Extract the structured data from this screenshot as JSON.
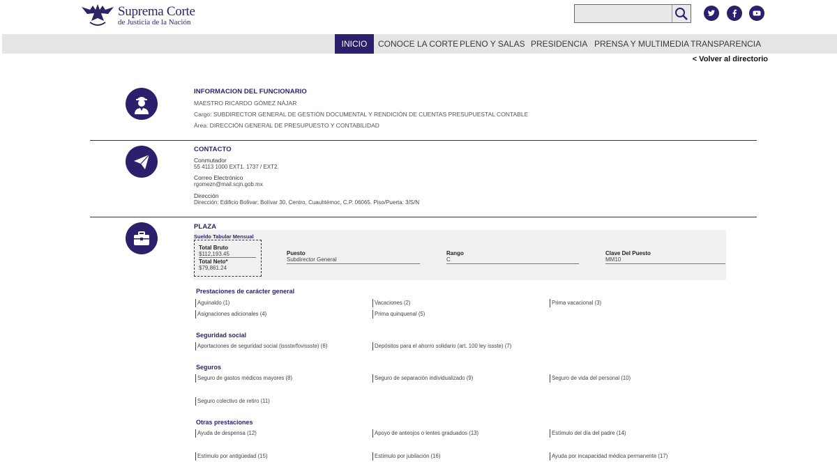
{
  "header": {
    "logo_title": "Suprema Corte",
    "logo_subtitle": "de Justicia de la Nación",
    "search": {
      "value": "",
      "placeholder": ""
    }
  },
  "nav": {
    "items": [
      {
        "label": "INICIO",
        "active": true
      },
      {
        "label": "CONOCE LA CORTE",
        "active": false
      },
      {
        "label": "PLENO Y SALAS",
        "active": false
      },
      {
        "label": "PRESIDENCIA",
        "active": false
      },
      {
        "label": "PRENSA Y MULTIMEDIA",
        "active": false
      },
      {
        "label": "TRANSPARENCIA",
        "active": false
      }
    ],
    "back_link": "< Volver al directorio"
  },
  "colors": {
    "brand": "#2c1f6b",
    "nav_bg": "#e5e5e5",
    "box_bg": "#f1f1f1"
  },
  "official": {
    "heading": "INFORMACION DEL FUNCIONARIO",
    "name": "MAESTRO RICARDO GÓMEZ NÁJAR",
    "cargo": "Cargo: SUBDIRECTOR GENERAL DE GESTIÓN DOCUMENTAL Y RENDICIÓN DE CUENTAS PRESUPUESTAL CONTABLE",
    "area": "Área: DIRECCIÓN GENERAL DE PRESUPUESTO Y CONTABILIDAD",
    "icon": "person-icon"
  },
  "contact": {
    "heading": "CONTACTO",
    "icon": "paper-plane-icon",
    "conmutador_label": "Conmutador",
    "conmutador_value": "55 4113 1000 EXT1. 1737 / EXT2.",
    "email_label": "Correo Electrónico",
    "email_value": "rgomezn@mail.scjn.gob.mx",
    "address_label": "Dirección",
    "address_value": "Dirección: Edificio Bolívar; Bolívar 30, Centro, Cuauhtémoc, C.P. 06065. Piso/Puerta: 3/S/N"
  },
  "plaza": {
    "heading": "PLAZA",
    "icon": "briefcase-icon",
    "sueldo_label": "Sueldo Tabular Mensual",
    "bruto_label": "Total Bruto",
    "bruto_value": "$112,193.45",
    "neto_label": "Total Neto*",
    "neto_value": "$79,861.24",
    "puesto_label": "Puesto",
    "puesto_value": "Subdirector General",
    "rango_label": "Rango",
    "rango_value": "C",
    "clave_label": "Clave Del Puesto",
    "clave_value": "MM10"
  },
  "benefits": [
    {
      "title": "Prestaciones de carácter general",
      "items": [
        "Aguinaldo (1)",
        "Vacaciones (2)",
        "Prima vacacional (3)",
        "Asignaciones adicionales (4)",
        "Prima quinquenal (5)"
      ]
    },
    {
      "title": "Seguridad social",
      "items": [
        "Aportaciones de seguridad social (issste/fovissste) (6)",
        "Depósitos para el ahorro solidario (art. 100 ley issste) (7)"
      ]
    },
    {
      "title": "Seguros",
      "items": [
        "Seguro de gastos médicos mayores (8)",
        "Seguro de separación individualizado (9)",
        "Seguro de vida del personal (10)",
        "Seguro colectivo de retiro (11)"
      ]
    },
    {
      "title": "Otras prestaciones",
      "items": [
        "Ayuda de despensa (12)",
        "Apoyo de anteojos o lentes graduados (13)",
        "Estímulo del día del padre (14)",
        "Estímulo por antigüedad (15)",
        "Estímulo por jubilación (16)",
        "Ayuda por incapacidad médica permanente (17)"
      ]
    }
  ]
}
